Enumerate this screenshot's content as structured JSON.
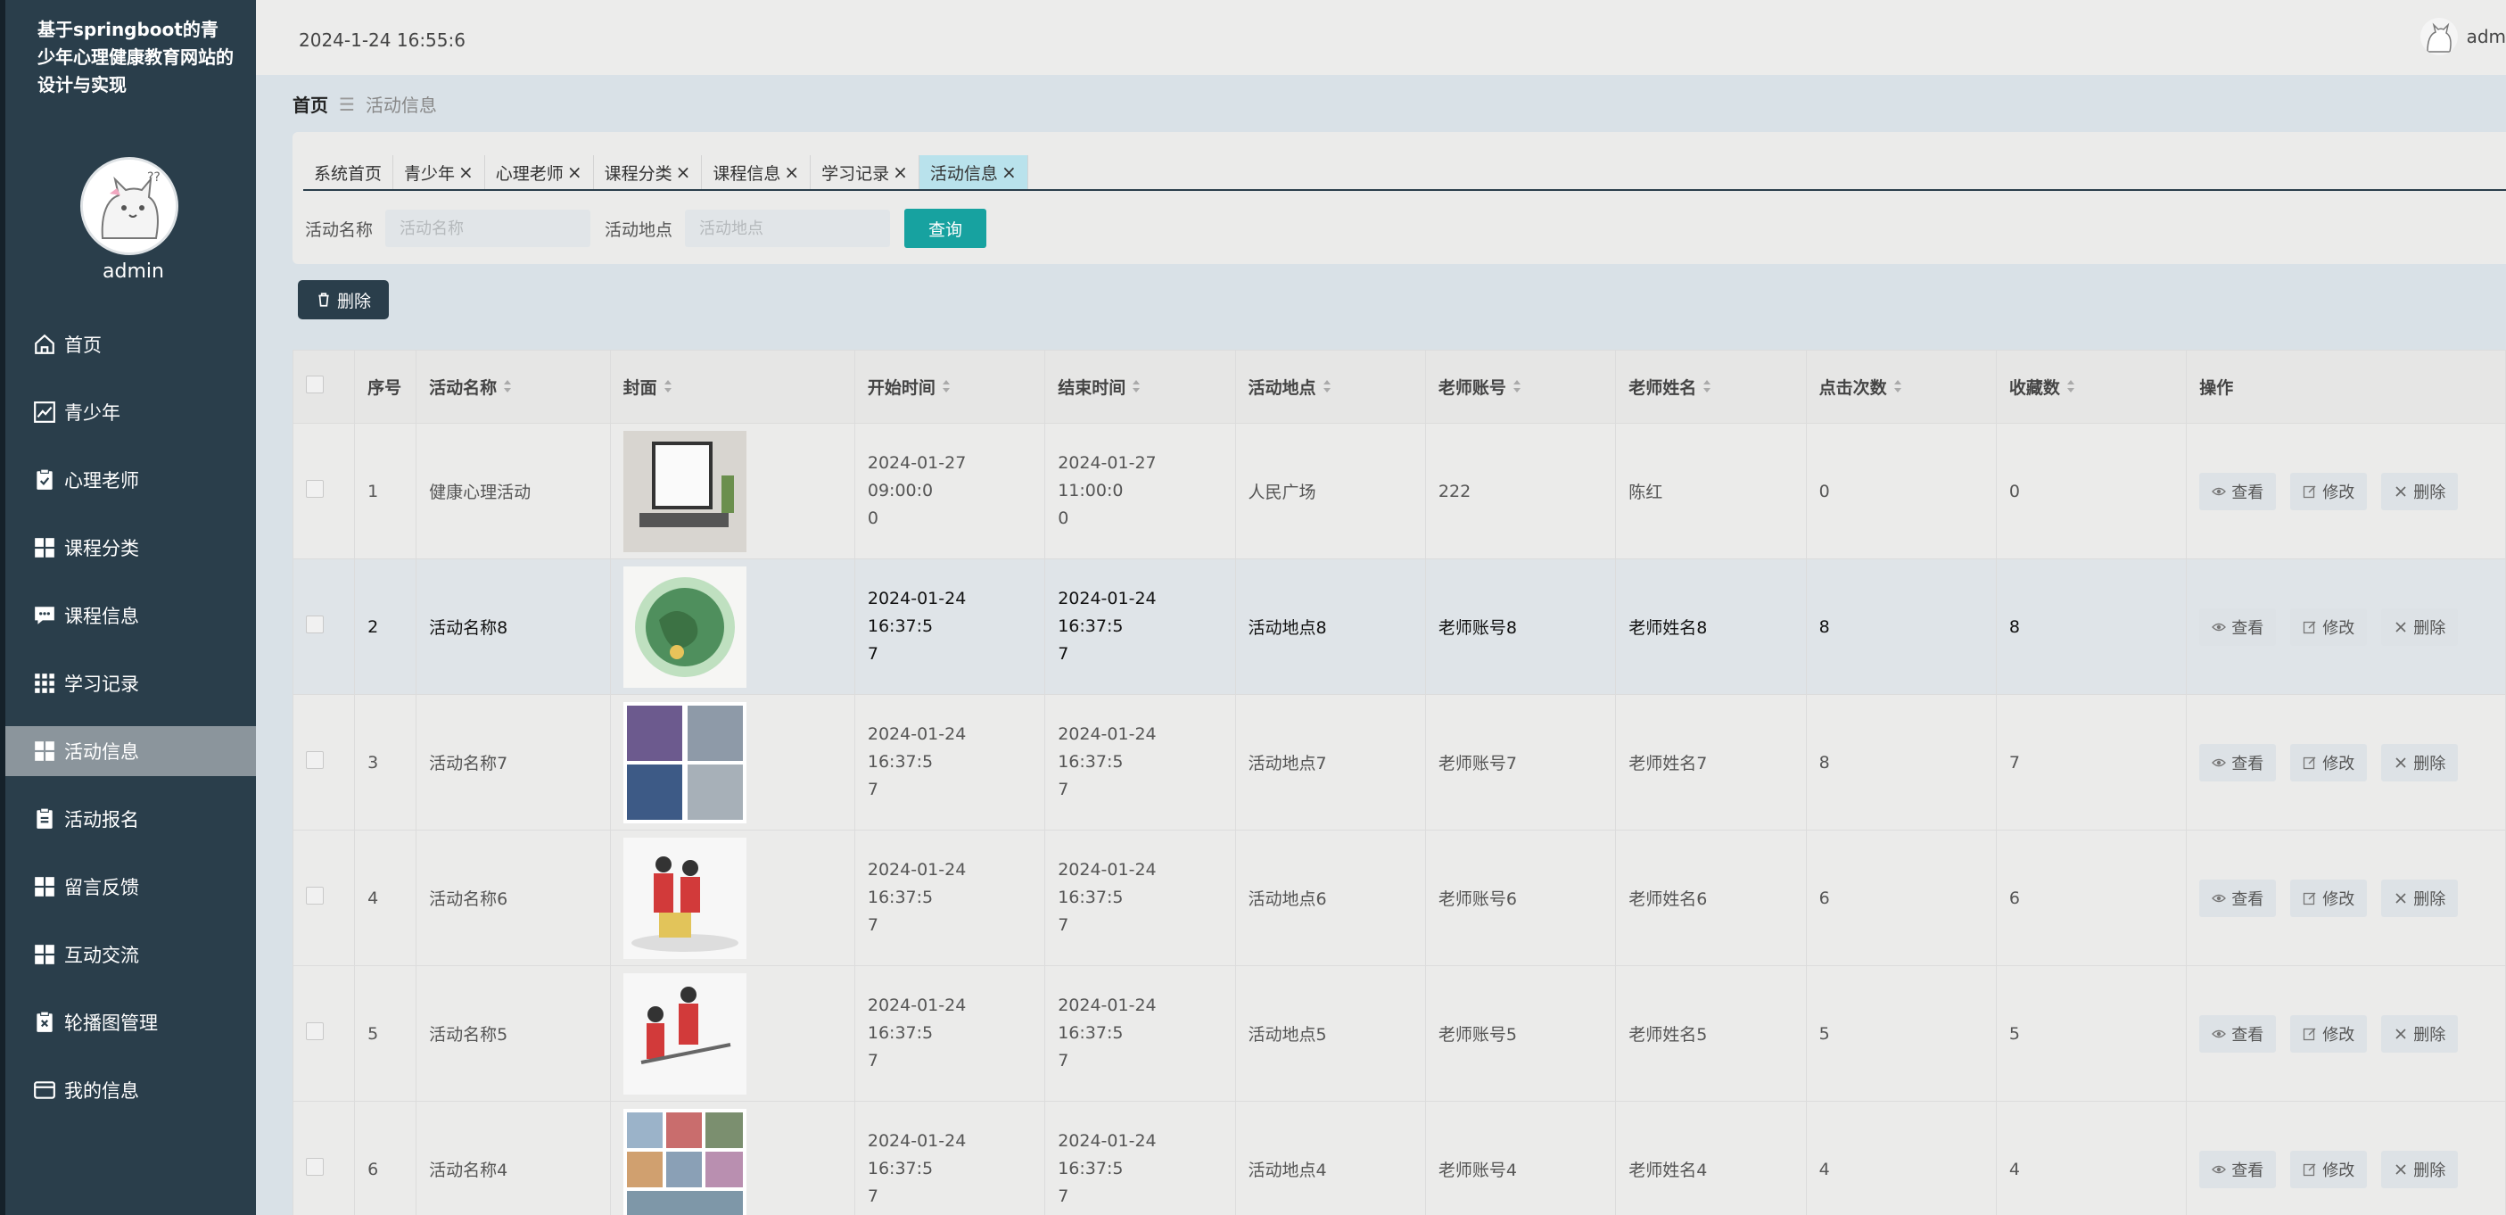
{
  "app": {
    "title": "基于springboot的青少年心理健康教育网站的设计与实现",
    "username": "admin"
  },
  "topbar": {
    "datetime": "2024-1-24 16:55:6",
    "user": "adm"
  },
  "menu": [
    {
      "label": "首页",
      "icon": "home-icon"
    },
    {
      "label": "青少年",
      "icon": "chart-icon"
    },
    {
      "label": "心理老师",
      "icon": "clipboard-check-icon"
    },
    {
      "label": "课程分类",
      "icon": "grid-icon"
    },
    {
      "label": "课程信息",
      "icon": "chat-icon"
    },
    {
      "label": "学习记录",
      "icon": "apps-icon"
    },
    {
      "label": "活动信息",
      "icon": "grid-icon",
      "active": true
    },
    {
      "label": "活动报名",
      "icon": "clipboard-icon"
    },
    {
      "label": "留言反馈",
      "icon": "grid-icon"
    },
    {
      "label": "互动交流",
      "icon": "grid-icon"
    },
    {
      "label": "轮播图管理",
      "icon": "clipboard-x-icon"
    },
    {
      "label": "我的信息",
      "icon": "card-icon"
    }
  ],
  "breadcrumb": {
    "home": "首页",
    "current": "活动信息"
  },
  "tabs": [
    {
      "label": "系统首页",
      "closable": false
    },
    {
      "label": "青少年",
      "closable": true
    },
    {
      "label": "心理老师",
      "closable": true
    },
    {
      "label": "课程分类",
      "closable": true
    },
    {
      "label": "课程信息",
      "closable": true
    },
    {
      "label": "学习记录",
      "closable": true
    },
    {
      "label": "活动信息",
      "closable": true,
      "active": true
    }
  ],
  "search": {
    "name_label": "活动名称",
    "name_placeholder": "活动名称",
    "place_label": "活动地点",
    "place_placeholder": "活动地点",
    "button": "查询"
  },
  "bulk_delete": "删除",
  "table": {
    "columns": [
      "序号",
      "活动名称",
      "封面",
      "开始时间",
      "结束时间",
      "活动地点",
      "老师账号",
      "老师姓名",
      "点击次数",
      "收藏数",
      "操作"
    ],
    "actions": {
      "view": "查看",
      "edit": "修改",
      "delete": "删除"
    },
    "rows": [
      {
        "no": "1",
        "name": "健康心理活动",
        "start_a": "2024-01-27 09:00:0",
        "start_b": "0",
        "end_a": "2024-01-27 11:00:0",
        "end_b": "0",
        "place": "人民广场",
        "account": "222",
        "teacher": "陈红",
        "clicks": "0",
        "favs": "0",
        "cover": "laptop"
      },
      {
        "no": "2",
        "name": "活动名称8",
        "start_a": "2024-01-24 16:37:5",
        "start_b": "7",
        "end_a": "2024-01-24 16:37:5",
        "end_b": "7",
        "place": "活动地点8",
        "account": "老师账号8",
        "teacher": "老师姓名8",
        "clicks": "8",
        "favs": "8",
        "cover": "globe",
        "highlight": true
      },
      {
        "no": "3",
        "name": "活动名称7",
        "start_a": "2024-01-24 16:37:5",
        "start_b": "7",
        "end_a": "2024-01-24 16:37:5",
        "end_b": "7",
        "place": "活动地点7",
        "account": "老师账号7",
        "teacher": "老师姓名7",
        "clicks": "8",
        "favs": "7",
        "cover": "collage"
      },
      {
        "no": "4",
        "name": "活动名称6",
        "start_a": "2024-01-24 16:37:5",
        "start_b": "7",
        "end_a": "2024-01-24 16:37:5",
        "end_b": "7",
        "place": "活动地点6",
        "account": "老师账号6",
        "teacher": "老师姓名6",
        "clicks": "6",
        "favs": "6",
        "cover": "volunteers"
      },
      {
        "no": "5",
        "name": "活动名称5",
        "start_a": "2024-01-24 16:37:5",
        "start_b": "7",
        "end_a": "2024-01-24 16:37:5",
        "end_b": "7",
        "place": "活动地点5",
        "account": "老师账号5",
        "teacher": "老师姓名5",
        "clicks": "5",
        "favs": "5",
        "cover": "volunteers2"
      },
      {
        "no": "6",
        "name": "活动名称4",
        "start_a": "2024-01-24 16:37:5",
        "start_b": "7",
        "end_a": "2024-01-24 16:37:5",
        "end_b": "7",
        "place": "活动地点4",
        "account": "老师账号4",
        "teacher": "老师姓名4",
        "clicks": "4",
        "favs": "4",
        "cover": "collage2"
      }
    ]
  }
}
